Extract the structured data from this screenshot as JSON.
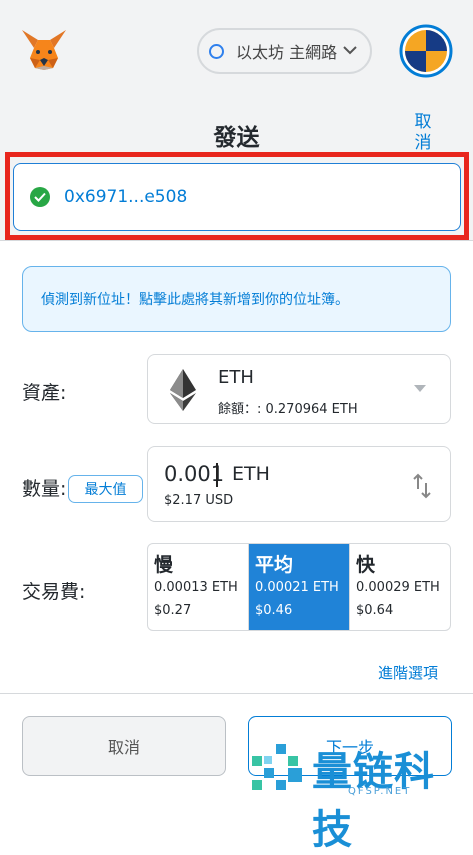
{
  "header": {
    "network_label": "以太坊 主網路",
    "title": "發送",
    "cancel_label": "取消"
  },
  "recipient": {
    "address": "0x6971...e508"
  },
  "notice": {
    "text": "偵測到新位址！點擊此處將其新增到你的位址簿。"
  },
  "asset": {
    "label": "資產:",
    "name": "ETH",
    "balance": "餘額：: 0.270964 ETH"
  },
  "amount": {
    "label": "數量:",
    "max_label": "最大值",
    "value": "0.001",
    "unit": "ETH",
    "usd": "$2.17 USD"
  },
  "fee": {
    "label": "交易費:",
    "options": [
      {
        "name": "慢",
        "eth": "0.00013 ETH",
        "usd": "$0.27",
        "selected": false
      },
      {
        "name": "平均",
        "eth": "0.00021 ETH",
        "usd": "$0.46",
        "selected": true
      },
      {
        "name": "快",
        "eth": "0.00029 ETH",
        "usd": "$0.64",
        "selected": false
      }
    ]
  },
  "advanced_label": "進階選項",
  "footer": {
    "cancel_label": "取消",
    "next_label": "下一步"
  },
  "watermark": {
    "text_cn": "量链科技",
    "text_en": "QFSP.NET"
  },
  "colors": {
    "accent": "#037dd6",
    "selected_fee": "#2083d7",
    "highlight_outline": "#e8261d",
    "success": "#28a745"
  }
}
